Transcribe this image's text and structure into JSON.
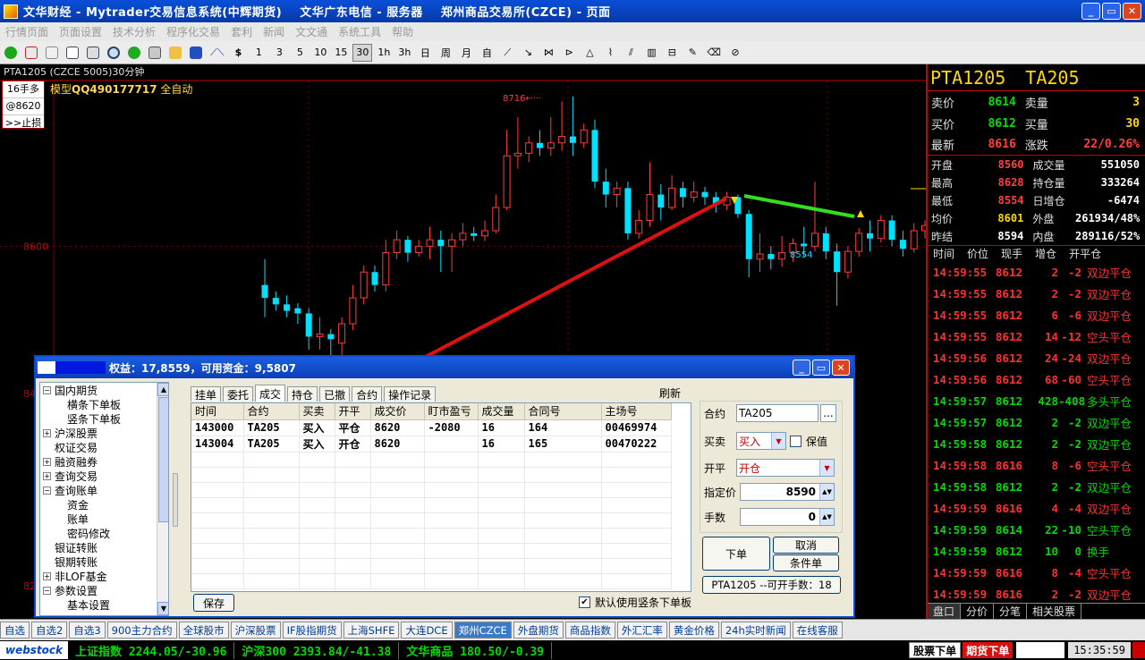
{
  "window": {
    "title": "文华财经 - Mytrader交易信息系统(中辉期货)    文华广东电信 - 服务器    郑州商品交易所(CZCE) - 页面",
    "min": "_",
    "max": "▭",
    "close": "✕"
  },
  "menu": [
    "行情页面",
    "页面设置",
    "技术分析",
    "程序化交易",
    "套利",
    "新闻",
    "文文通",
    "系统工具",
    "帮助"
  ],
  "toolbar": {
    "periods": [
      "$",
      "1",
      "3",
      "5",
      "10",
      "15",
      "30",
      "1h",
      "3h",
      "日",
      "周",
      "月",
      "自"
    ],
    "selected": "30"
  },
  "chart": {
    "title": "PTA1205 (CZCE 5005)30分钟",
    "model_prefix": "模型",
    "model_name": "QQ490177717",
    "model_suffix": "全自动",
    "order_box": [
      "16手多",
      "@8620",
      ">>止损"
    ],
    "high_label": "8716",
    "low_label": "8554",
    "price_axis": [
      "8600",
      "84",
      "82"
    ]
  },
  "chart_data": {
    "type": "candlestick",
    "title": "PTA1205 (CZCE 5005)30分钟",
    "y_tick_labels": [
      "8600"
    ],
    "annotations": [
      {
        "label": "8716"
      },
      {
        "label": "8554"
      }
    ],
    "candles": [
      {
        "o": 8570,
        "c": 8560,
        "h": 8590,
        "l": 8545
      },
      {
        "o": 8560,
        "c": 8555,
        "h": 8565,
        "l": 8550
      },
      {
        "o": 8555,
        "c": 8550,
        "h": 8562,
        "l": 8545
      },
      {
        "o": 8552,
        "c": 8548,
        "h": 8556,
        "l": 8540
      },
      {
        "o": 8548,
        "c": 8530,
        "h": 8552,
        "l": 8520
      },
      {
        "o": 8530,
        "c": 8532,
        "h": 8545,
        "l": 8520
      },
      {
        "o": 8532,
        "c": 8528,
        "h": 8536,
        "l": 8515
      },
      {
        "o": 8525,
        "c": 8540,
        "h": 8545,
        "l": 8515
      },
      {
        "o": 8540,
        "c": 8560,
        "h": 8570,
        "l": 8535
      },
      {
        "o": 8560,
        "c": 8580,
        "h": 8585,
        "l": 8555
      },
      {
        "o": 8580,
        "c": 8570,
        "h": 8585,
        "l": 8565
      },
      {
        "o": 8570,
        "c": 8595,
        "h": 8605,
        "l": 8565
      },
      {
        "o": 8595,
        "c": 8605,
        "h": 8612,
        "l": 8590
      },
      {
        "o": 8605,
        "c": 8595,
        "h": 8608,
        "l": 8588
      },
      {
        "o": 8595,
        "c": 8600,
        "h": 8605,
        "l": 8592
      },
      {
        "o": 8600,
        "c": 8605,
        "h": 8615,
        "l": 8590
      },
      {
        "o": 8605,
        "c": 8600,
        "h": 8612,
        "l": 8580
      },
      {
        "o": 8600,
        "c": 8605,
        "h": 8610,
        "l": 8580
      },
      {
        "o": 8605,
        "c": 8610,
        "h": 8618,
        "l": 8600
      },
      {
        "o": 8610,
        "c": 8608,
        "h": 8615,
        "l": 8604
      },
      {
        "o": 8608,
        "c": 8612,
        "h": 8620,
        "l": 8604
      },
      {
        "o": 8612,
        "c": 8630,
        "h": 8640,
        "l": 8610
      },
      {
        "o": 8630,
        "c": 8670,
        "h": 8690,
        "l": 8628
      },
      {
        "o": 8670,
        "c": 8672,
        "h": 8700,
        "l": 8660
      },
      {
        "o": 8672,
        "c": 8680,
        "h": 8685,
        "l": 8665
      },
      {
        "o": 8680,
        "c": 8676,
        "h": 8690,
        "l": 8670
      },
      {
        "o": 8676,
        "c": 8680,
        "h": 8700,
        "l": 8670
      },
      {
        "o": 8680,
        "c": 8685,
        "h": 8712,
        "l": 8674
      },
      {
        "o": 8685,
        "c": 8680,
        "h": 8716,
        "l": 8670
      },
      {
        "o": 8680,
        "c": 8690,
        "h": 8695,
        "l": 8676
      },
      {
        "o": 8690,
        "c": 8650,
        "h": 8698,
        "l": 8645
      },
      {
        "o": 8650,
        "c": 8640,
        "h": 8660,
        "l": 8630
      },
      {
        "o": 8640,
        "c": 8645,
        "h": 8650,
        "l": 8630
      },
      {
        "o": 8645,
        "c": 8610,
        "h": 8650,
        "l": 8605
      },
      {
        "o": 8610,
        "c": 8620,
        "h": 8628,
        "l": 8606
      },
      {
        "o": 8620,
        "c": 8640,
        "h": 8665,
        "l": 8615
      },
      {
        "o": 8640,
        "c": 8630,
        "h": 8648,
        "l": 8620
      },
      {
        "o": 8630,
        "c": 8645,
        "h": 8655,
        "l": 8628
      },
      {
        "o": 8645,
        "c": 8638,
        "h": 8650,
        "l": 8630
      },
      {
        "o": 8638,
        "c": 8642,
        "h": 8650,
        "l": 8634
      },
      {
        "o": 8642,
        "c": 8638,
        "h": 8646,
        "l": 8632
      },
      {
        "o": 8638,
        "c": 8632,
        "h": 8642,
        "l": 8626
      },
      {
        "o": 8632,
        "c": 8638,
        "h": 8642,
        "l": 8628
      },
      {
        "o": 8638,
        "c": 8625,
        "h": 8640,
        "l": 8622
      },
      {
        "o": 8625,
        "c": 8590,
        "h": 8628,
        "l": 8576
      },
      {
        "o": 8590,
        "c": 8594,
        "h": 8610,
        "l": 8580
      },
      {
        "o": 8594,
        "c": 8590,
        "h": 8600,
        "l": 8582
      },
      {
        "o": 8590,
        "c": 8595,
        "h": 8608,
        "l": 8584
      },
      {
        "o": 8595,
        "c": 8602,
        "h": 8606,
        "l": 8588
      },
      {
        "o": 8602,
        "c": 8600,
        "h": 8615,
        "l": 8592
      },
      {
        "o": 8600,
        "c": 8610,
        "h": 8650,
        "l": 8596
      },
      {
        "o": 8610,
        "c": 8596,
        "h": 8615,
        "l": 8590
      },
      {
        "o": 8596,
        "c": 8580,
        "h": 8602,
        "l": 8554
      },
      {
        "o": 8580,
        "c": 8596,
        "h": 8600,
        "l": 8575
      },
      {
        "o": 8596,
        "c": 8610,
        "h": 8614,
        "l": 8592
      },
      {
        "o": 8610,
        "c": 8606,
        "h": 8620,
        "l": 8596
      },
      {
        "o": 8606,
        "c": 8620,
        "h": 8624,
        "l": 8603
      },
      {
        "o": 8620,
        "c": 8605,
        "h": 8624,
        "l": 8600
      },
      {
        "o": 8605,
        "c": 8598,
        "h": 8612,
        "l": 8592
      },
      {
        "o": 8598,
        "c": 8612,
        "h": 8618,
        "l": 8595
      },
      {
        "o": 8612,
        "c": 8616,
        "h": 8620,
        "l": 8606
      }
    ]
  },
  "quote": {
    "symbol": "PTA1205",
    "symbol2": "TA205",
    "rows": [
      {
        "l1": "卖价",
        "v1": "8614",
        "c1": "#00e000",
        "l2": "卖量",
        "v2": "3",
        "c2": "#ffd800"
      },
      {
        "l1": "买价",
        "v1": "8612",
        "c1": "#00e000",
        "l2": "买量",
        "v2": "30",
        "c2": "#ffd800"
      },
      {
        "l1": "最新",
        "v1": "8616",
        "c1": "#ff4040",
        "l2": "涨跌",
        "v2": "22/0.26%",
        "c2": "#ff4040"
      }
    ],
    "stats": [
      {
        "l1": "开盘",
        "v1": "8560",
        "c1": "#ff4040",
        "l2": "成交量",
        "v2": "551050",
        "c2": "#ffffff"
      },
      {
        "l1": "最高",
        "v1": "8628",
        "c1": "#ff4040",
        "l2": "持仓量",
        "v2": "333264",
        "c2": "#ffffff"
      },
      {
        "l1": "最低",
        "v1": "8554",
        "c1": "#ff4040",
        "l2": "日增仓",
        "v2": "-6474",
        "c2": "#ffffff"
      },
      {
        "l1": "均价",
        "v1": "8601",
        "c1": "#ffd800",
        "l2": "外盘",
        "v2": "261934/48%",
        "c2": "#ffffff"
      },
      {
        "l1": "昨结",
        "v1": "8594",
        "c1": "#ffffff",
        "l2": "内盘",
        "v2": "289116/52%",
        "c2": "#ffffff"
      }
    ],
    "tick_headers": [
      "时间",
      "价位",
      "现手",
      "增仓",
      "开平仓"
    ],
    "ticks": [
      {
        "t": "14:59:55",
        "p": "8612",
        "v": "2",
        "c": "-2",
        "k": "双边平仓",
        "col": "#ff3030"
      },
      {
        "t": "14:59:55",
        "p": "8612",
        "v": "2",
        "c": "-2",
        "k": "双边平仓",
        "col": "#ff3030"
      },
      {
        "t": "14:59:55",
        "p": "8612",
        "v": "6",
        "c": "-6",
        "k": "双边平仓",
        "col": "#ff3030"
      },
      {
        "t": "14:59:55",
        "p": "8612",
        "v": "14",
        "c": "-12",
        "k": "空头平仓",
        "col": "#ff3030"
      },
      {
        "t": "14:59:56",
        "p": "8612",
        "v": "24",
        "c": "-24",
        "k": "双边平仓",
        "col": "#ff3030"
      },
      {
        "t": "14:59:56",
        "p": "8612",
        "v": "68",
        "c": "-60",
        "k": "空头平仓",
        "col": "#ff3030"
      },
      {
        "t": "14:59:57",
        "p": "8612",
        "v": "428",
        "c": "-408",
        "k": "多头平仓",
        "col": "#00dc00"
      },
      {
        "t": "14:59:57",
        "p": "8612",
        "v": "2",
        "c": "-2",
        "k": "双边平仓",
        "col": "#00dc00"
      },
      {
        "t": "14:59:58",
        "p": "8612",
        "v": "2",
        "c": "-2",
        "k": "双边平仓",
        "col": "#00dc00"
      },
      {
        "t": "14:59:58",
        "p": "8616",
        "v": "8",
        "c": "-6",
        "k": "空头平仓",
        "col": "#ff3030"
      },
      {
        "t": "14:59:58",
        "p": "8612",
        "v": "2",
        "c": "-2",
        "k": "双边平仓",
        "col": "#00dc00"
      },
      {
        "t": "14:59:59",
        "p": "8616",
        "v": "4",
        "c": "-4",
        "k": "双边平仓",
        "col": "#ff3030"
      },
      {
        "t": "14:59:59",
        "p": "8614",
        "v": "22",
        "c": "-10",
        "k": "空头平仓",
        "col": "#00dc00"
      },
      {
        "t": "14:59:59",
        "p": "8612",
        "v": "10",
        "c": "0",
        "k": "换手",
        "col": "#00dc00"
      },
      {
        "t": "14:59:59",
        "p": "8616",
        "v": "8",
        "c": "-4",
        "k": "空头平仓",
        "col": "#ff3030"
      },
      {
        "t": "14:59:59",
        "p": "8616",
        "v": "2",
        "c": "-2",
        "k": "双边平仓",
        "col": "#ff3030"
      }
    ],
    "tabs": [
      "盘口",
      "分价",
      "分笔",
      "相关股票"
    ]
  },
  "dialog": {
    "equity_label": "权益：17,8559，可用资金：9,5807",
    "tree": [
      {
        "level": 0,
        "box": "−",
        "label": "国内期货"
      },
      {
        "level": 2,
        "label": "横条下单板"
      },
      {
        "level": 2,
        "label": "竖条下单板"
      },
      {
        "level": 0,
        "box": "+",
        "label": "沪深股票"
      },
      {
        "level": 1,
        "label": "权证交易"
      },
      {
        "level": 0,
        "box": "+",
        "label": "融资融券"
      },
      {
        "level": 0,
        "box": "+",
        "label": "查询交易"
      },
      {
        "level": 0,
        "box": "−",
        "label": "查询账单"
      },
      {
        "level": 2,
        "label": "资金"
      },
      {
        "level": 2,
        "label": "账单"
      },
      {
        "level": 2,
        "label": "密码修改"
      },
      {
        "level": 1,
        "label": "银证转账"
      },
      {
        "level": 1,
        "label": "银期转账"
      },
      {
        "level": 0,
        "box": "+",
        "label": "非LOF基金"
      },
      {
        "level": 0,
        "box": "−",
        "label": "参数设置"
      },
      {
        "level": 2,
        "label": "基本设置"
      }
    ],
    "tabs": [
      "挂单",
      "委托",
      "成交",
      "持仓",
      "已撤",
      "合约",
      "操作记录"
    ],
    "active_tab": "成交",
    "refresh": "刷新",
    "columns": [
      "时间",
      "合约",
      "买卖",
      "开平",
      "成交价",
      "盯市盈亏",
      "成交量",
      "合同号",
      "主场号"
    ],
    "rows": [
      [
        "143000",
        "TA205",
        "买入",
        "平仓",
        "8620",
        "-2080",
        "16",
        "164",
        "00469974"
      ],
      [
        "143004",
        "TA205",
        "买入",
        "开仓",
        "8620",
        "",
        "16",
        "165",
        "00470222"
      ]
    ],
    "save": "保存",
    "default_chk": "默认使用竖条下单板",
    "order": {
      "contract_label": "合约",
      "contract": "TA205",
      "browse": "...",
      "side_label": "买卖",
      "side": "买入",
      "hedge": "保值",
      "oc_label": "开平",
      "oc": "开仓",
      "price_label": "指定价",
      "price": "8590",
      "qty_label": "手数",
      "qty": "0",
      "submit": "下单",
      "cancel": "取消",
      "cond": "条件单",
      "available": "PTA1205 --可开手数：18"
    }
  },
  "bottom_tabs": [
    "自选",
    "自选2",
    "自选3",
    "900主力合约",
    "全球股市",
    "沪深股票",
    "IF股指期货",
    "上海SHFE",
    "大连DCE",
    "郑州CZCE",
    "外盘期货",
    "商品指数",
    "外汇汇率",
    "黄金价格",
    "24h实时新闻",
    "在线客服"
  ],
  "bottom_active": "郑州CZCE",
  "status": {
    "logo": "webstock",
    "idx1_name": "上证指数",
    "idx1_val": "2244.05/-30.96",
    "idx2_name": "沪深300",
    "idx2_val": "2393.84/-41.38",
    "idx3_name": "文华商品",
    "idx3_val": "180.50/-0.39",
    "stock_btn": "股票下单",
    "fut_btn": "期货下单",
    "clock": "15:35:59"
  }
}
